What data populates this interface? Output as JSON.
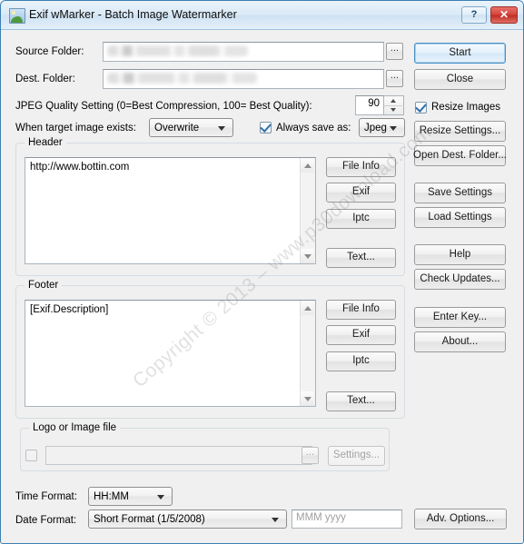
{
  "window": {
    "title": "Exif wMarker - Batch Image Watermarker",
    "icon": "image-picture-icon",
    "help_button": "?",
    "close_button": "✕",
    "background_color": "#f0f0f0",
    "border_color": "#3c7fb1"
  },
  "form": {
    "source_folder_label": "Source Folder:",
    "source_folder_value": "",
    "dest_folder_label": "Dest. Folder:",
    "dest_folder_value": "",
    "browse_button": "...",
    "jpeg_quality_label": "JPEG Quality Setting (0=Best Compression, 100= Best Quality):",
    "jpeg_quality_value": "90",
    "target_exists_label": "When target image exists:",
    "target_exists_value": "Overwrite",
    "always_save_as_label": "Always save as:",
    "always_save_as_checked": true,
    "save_format_value": "Jpeg"
  },
  "header_group": {
    "title": "Header",
    "text": "http://www.bottin.com",
    "buttons": [
      "File Info",
      "Exif",
      "Iptc",
      "Text..."
    ]
  },
  "footer_group": {
    "title": "Footer",
    "text": "[Exif.Description]",
    "buttons": [
      "File Info",
      "Exif",
      "Iptc",
      "Text..."
    ]
  },
  "logo_group": {
    "title": "Logo or Image file",
    "enabled": false,
    "path_value": "",
    "browse_button": "...",
    "settings_button": "Settings..."
  },
  "formats": {
    "time_format_label": "Time Format:",
    "time_format_value": "HH:MM",
    "date_format_label": "Date Format:",
    "date_format_value": "Short Format (1/5/2008)",
    "custom_format_placeholder": "MMM yyyy",
    "custom_format_value": "",
    "adv_options_button": "Adv. Options..."
  },
  "side_panel": {
    "start_button": "Start",
    "close_button": "Close",
    "resize_images_label": "Resize Images",
    "resize_images_checked": true,
    "resize_settings_button": "Resize Settings...",
    "open_dest_folder_button": "Open Dest. Folder...",
    "save_settings_button": "Save Settings",
    "load_settings_button": "Load Settings",
    "help_button": "Help",
    "check_updates_button": "Check Updates...",
    "enter_key_button": "Enter Key...",
    "about_button": "About..."
  },
  "watermark": {
    "text": "Copyright © 2013 – www.p30download.com"
  }
}
